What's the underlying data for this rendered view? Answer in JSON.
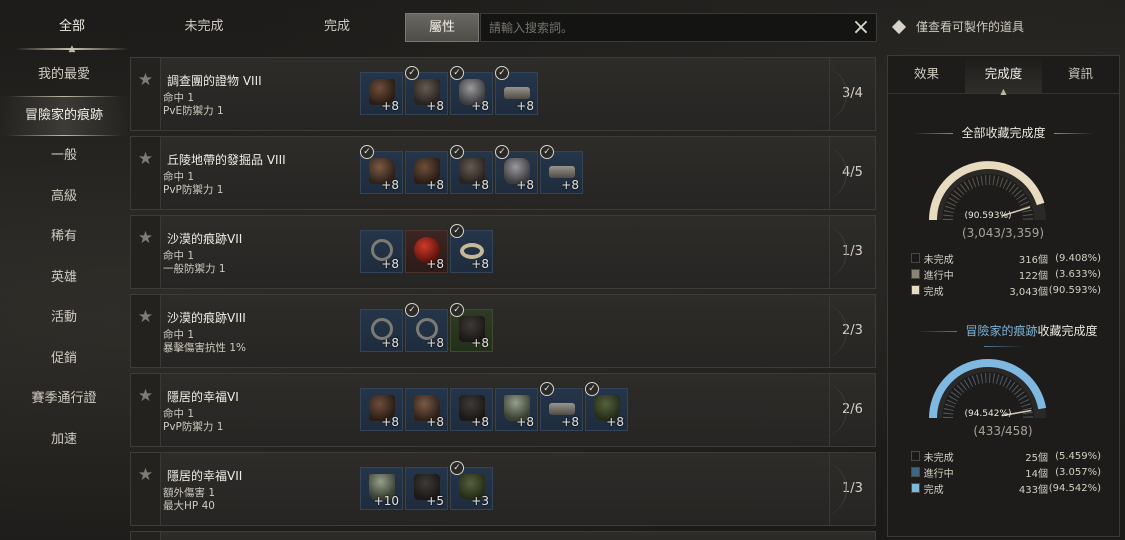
{
  "top_tabs": [
    "全部",
    "未完成",
    "完成"
  ],
  "attribute_button": "屬性",
  "search": {
    "placeholder": "請輸入搜索詞。",
    "clear_icon": "×"
  },
  "craftable_filter_label": "僅查看可製作的道具",
  "sidebar": [
    "我的最愛",
    "冒險家的痕跡",
    "一般",
    "高級",
    "稀有",
    "英雄",
    "活動",
    "促銷",
    "賽季通行證",
    "加速"
  ],
  "sidebar_active_index": 1,
  "rows": [
    {
      "title": "調查團的證物 VIII",
      "stat1": "命中 1",
      "stat2": "PvE防禦力 1",
      "count": "3/4",
      "items": [
        {
          "icon": "gloves-icon",
          "plus": "+8",
          "done": false,
          "kind": "glove",
          "bg": "blue"
        },
        {
          "icon": "pants-icon",
          "plus": "+8",
          "done": true,
          "kind": "pants",
          "bg": "blue"
        },
        {
          "icon": "armor-icon",
          "plus": "+8",
          "done": true,
          "kind": "armor",
          "bg": "blue"
        },
        {
          "icon": "belt-icon",
          "plus": "+8",
          "done": true,
          "kind": "belt",
          "bg": "blue"
        }
      ]
    },
    {
      "title": "丘陵地帶的發掘品 VIII",
      "stat1": "命中 1",
      "stat2": "PvP防禦力 1",
      "count": "4/5",
      "items": [
        {
          "icon": "boots-icon",
          "plus": "+8",
          "done": true,
          "kind": "boot",
          "bg": "blue"
        },
        {
          "icon": "gloves-icon",
          "plus": "+8",
          "done": false,
          "kind": "glove",
          "bg": "blue"
        },
        {
          "icon": "pants-icon",
          "plus": "+8",
          "done": true,
          "kind": "pants",
          "bg": "blue"
        },
        {
          "icon": "armor-icon",
          "plus": "+8",
          "done": true,
          "kind": "armor",
          "bg": "blue"
        },
        {
          "icon": "belt-icon",
          "plus": "+8",
          "done": true,
          "kind": "belt",
          "bg": "blue"
        }
      ]
    },
    {
      "title": "沙漠的痕跡VII",
      "stat1": "命中 1",
      "stat2": "一般防禦力 1",
      "count": "1/3",
      "items": [
        {
          "icon": "necklace-icon",
          "plus": "+8",
          "done": false,
          "kind": "necklace",
          "bg": "blue"
        },
        {
          "icon": "red-gem-icon",
          "plus": "+8",
          "done": false,
          "kind": "redgem",
          "bg": "red"
        },
        {
          "icon": "ring-icon",
          "plus": "+8",
          "done": true,
          "kind": "ring",
          "bg": "blue"
        }
      ]
    },
    {
      "title": "沙漠的痕跡VIII",
      "stat1": "命中 1",
      "stat2": "暴擊傷害抗性 1%",
      "count": "2/3",
      "items": [
        {
          "icon": "necklace-icon",
          "plus": "+8",
          "done": false,
          "kind": "necklace",
          "bg": "blue"
        },
        {
          "icon": "necklace-icon",
          "plus": "+8",
          "done": true,
          "kind": "necklace",
          "bg": "blue"
        },
        {
          "icon": "belt-icon",
          "plus": "+8",
          "done": true,
          "kind": "tunic",
          "bg": "green"
        }
      ]
    },
    {
      "title": "隱居的幸福VI",
      "stat1": "命中 1",
      "stat2": "PvP防禦力 1",
      "count": "2/6",
      "items": [
        {
          "icon": "gloves-icon",
          "plus": "+8",
          "done": false,
          "kind": "glove",
          "bg": "blue"
        },
        {
          "icon": "boots-icon",
          "plus": "+8",
          "done": false,
          "kind": "boot",
          "bg": "blue"
        },
        {
          "icon": "tunic-icon",
          "plus": "+8",
          "done": false,
          "kind": "tunic",
          "bg": "blue"
        },
        {
          "icon": "skirt-icon",
          "plus": "+8",
          "done": false,
          "kind": "skirt",
          "bg": "blue"
        },
        {
          "icon": "belt-icon",
          "plus": "+8",
          "done": true,
          "kind": "belt",
          "bg": "blue"
        },
        {
          "icon": "cloak-icon",
          "plus": "+8",
          "done": true,
          "kind": "cloak",
          "bg": "blue"
        }
      ]
    },
    {
      "title": "隱居的幸福VII",
      "stat1": "額外傷害 1",
      "stat2": "最大HP 40",
      "count": "1/3",
      "items": [
        {
          "icon": "skirt-icon",
          "plus": "+10",
          "done": false,
          "kind": "skirt",
          "bg": "blue"
        },
        {
          "icon": "tunic-icon",
          "plus": "+5",
          "done": false,
          "kind": "tunic",
          "bg": "blue"
        },
        {
          "icon": "cloak-icon",
          "plus": "+3",
          "done": true,
          "kind": "cloak",
          "bg": "blue"
        }
      ]
    }
  ],
  "right_panel": {
    "tabs": [
      "效果",
      "完成度",
      "資訊"
    ],
    "active_tab": 1,
    "all": {
      "title": "全部收藏完成度",
      "percent_label": "(90.593%)",
      "fraction": "(3,043/3,359)",
      "percent": 90.593,
      "colors": {
        "incomplete": "#1a1a1a",
        "in_progress": "#8b8578",
        "complete": "#e8dcc0"
      },
      "legend": [
        {
          "name": "未完成",
          "count": "316個",
          "pct": "(9.408%)"
        },
        {
          "name": "進行中",
          "count": "122個",
          "pct": "(3.633%)"
        },
        {
          "name": "完成",
          "count": "3,043個",
          "pct": "(90.593%)"
        }
      ]
    },
    "trace": {
      "title_highlight": "冒險家的痕跡",
      "title_rest": "收藏完成度",
      "percent_label": "(94.542%)",
      "fraction": "(433/458)",
      "percent": 94.542,
      "colors": {
        "incomplete": "#1a1a1a",
        "in_progress": "#3d6685",
        "complete": "#7fb8e0"
      },
      "legend": [
        {
          "name": "未完成",
          "count": "25個",
          "pct": "(5.459%)"
        },
        {
          "name": "進行中",
          "count": "14個",
          "pct": "(3.057%)"
        },
        {
          "name": "完成",
          "count": "433個",
          "pct": "(94.542%)"
        }
      ]
    }
  }
}
